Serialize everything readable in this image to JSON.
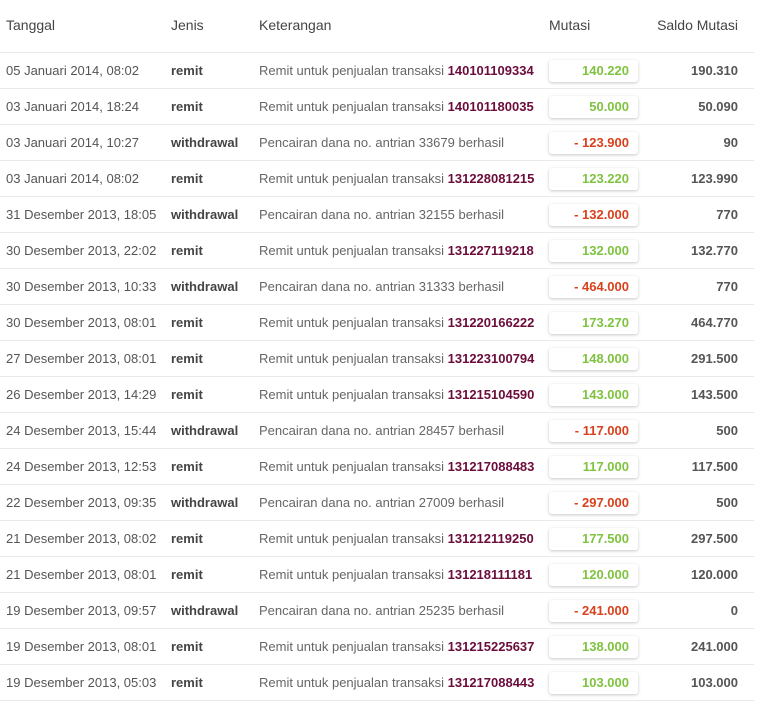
{
  "header": {
    "tanggal": "Tanggal",
    "jenis": "Jenis",
    "keterangan": "Keterangan",
    "mutasi": "Mutasi",
    "saldo": "Saldo Mutasi"
  },
  "colors": {
    "positive": "#7fc340",
    "negative": "#d8411d",
    "transaction_id": "#6b0c3b"
  },
  "rows": [
    {
      "date": "05 Januari 2014, 08:02",
      "type": "remit",
      "desc": "Remit untuk penjualan transaksi",
      "trx": "140101109334",
      "mutasi": "140.220",
      "sign": "pos",
      "saldo": "190.310"
    },
    {
      "date": "03 Januari 2014, 18:24",
      "type": "remit",
      "desc": "Remit untuk penjualan transaksi",
      "trx": "140101180035",
      "mutasi": "50.000",
      "sign": "pos",
      "saldo": "50.090"
    },
    {
      "date": "03 Januari 2014, 10:27",
      "type": "withdrawal",
      "desc": "Pencairan dana no. antrian 33679 berhasil",
      "trx": "",
      "mutasi": "- 123.900",
      "sign": "neg",
      "saldo": "90"
    },
    {
      "date": "03 Januari 2014, 08:02",
      "type": "remit",
      "desc": "Remit untuk penjualan transaksi",
      "trx": "131228081215",
      "mutasi": "123.220",
      "sign": "pos",
      "saldo": "123.990"
    },
    {
      "date": "31 Desember 2013, 18:05",
      "type": "withdrawal",
      "desc": "Pencairan dana no. antrian 32155 berhasil",
      "trx": "",
      "mutasi": "- 132.000",
      "sign": "neg",
      "saldo": "770"
    },
    {
      "date": "30 Desember 2013, 22:02",
      "type": "remit",
      "desc": "Remit untuk penjualan transaksi",
      "trx": "131227119218",
      "mutasi": "132.000",
      "sign": "pos",
      "saldo": "132.770"
    },
    {
      "date": "30 Desember 2013, 10:33",
      "type": "withdrawal",
      "desc": "Pencairan dana no. antrian 31333 berhasil",
      "trx": "",
      "mutasi": "- 464.000",
      "sign": "neg",
      "saldo": "770"
    },
    {
      "date": "30 Desember 2013, 08:01",
      "type": "remit",
      "desc": "Remit untuk penjualan transaksi",
      "trx": "131220166222",
      "mutasi": "173.270",
      "sign": "pos",
      "saldo": "464.770"
    },
    {
      "date": "27 Desember 2013, 08:01",
      "type": "remit",
      "desc": "Remit untuk penjualan transaksi",
      "trx": "131223100794",
      "mutasi": "148.000",
      "sign": "pos",
      "saldo": "291.500"
    },
    {
      "date": "26 Desember 2013, 14:29",
      "type": "remit",
      "desc": "Remit untuk penjualan transaksi",
      "trx": "131215104590",
      "mutasi": "143.000",
      "sign": "pos",
      "saldo": "143.500"
    },
    {
      "date": "24 Desember 2013, 15:44",
      "type": "withdrawal",
      "desc": "Pencairan dana no. antrian 28457 berhasil",
      "trx": "",
      "mutasi": "- 117.000",
      "sign": "neg",
      "saldo": "500"
    },
    {
      "date": "24 Desember 2013, 12:53",
      "type": "remit",
      "desc": "Remit untuk penjualan transaksi",
      "trx": "131217088483",
      "mutasi": "117.000",
      "sign": "pos",
      "saldo": "117.500"
    },
    {
      "date": "22 Desember 2013, 09:35",
      "type": "withdrawal",
      "desc": "Pencairan dana no. antrian 27009 berhasil",
      "trx": "",
      "mutasi": "- 297.000",
      "sign": "neg",
      "saldo": "500"
    },
    {
      "date": "21 Desember 2013, 08:02",
      "type": "remit",
      "desc": "Remit untuk penjualan transaksi",
      "trx": "131212119250",
      "mutasi": "177.500",
      "sign": "pos",
      "saldo": "297.500"
    },
    {
      "date": "21 Desember 2013, 08:01",
      "type": "remit",
      "desc": "Remit untuk penjualan transaksi",
      "trx": "131218111181",
      "mutasi": "120.000",
      "sign": "pos",
      "saldo": "120.000"
    },
    {
      "date": "19 Desember 2013, 09:57",
      "type": "withdrawal",
      "desc": "Pencairan dana no. antrian 25235 berhasil",
      "trx": "",
      "mutasi": "- 241.000",
      "sign": "neg",
      "saldo": "0"
    },
    {
      "date": "19 Desember 2013, 08:01",
      "type": "remit",
      "desc": "Remit untuk penjualan transaksi",
      "trx": "131215225637",
      "mutasi": "138.000",
      "sign": "pos",
      "saldo": "241.000"
    },
    {
      "date": "19 Desember 2013, 05:03",
      "type": "remit",
      "desc": "Remit untuk penjualan transaksi",
      "trx": "131217088443",
      "mutasi": "103.000",
      "sign": "pos",
      "saldo": "103.000"
    }
  ]
}
